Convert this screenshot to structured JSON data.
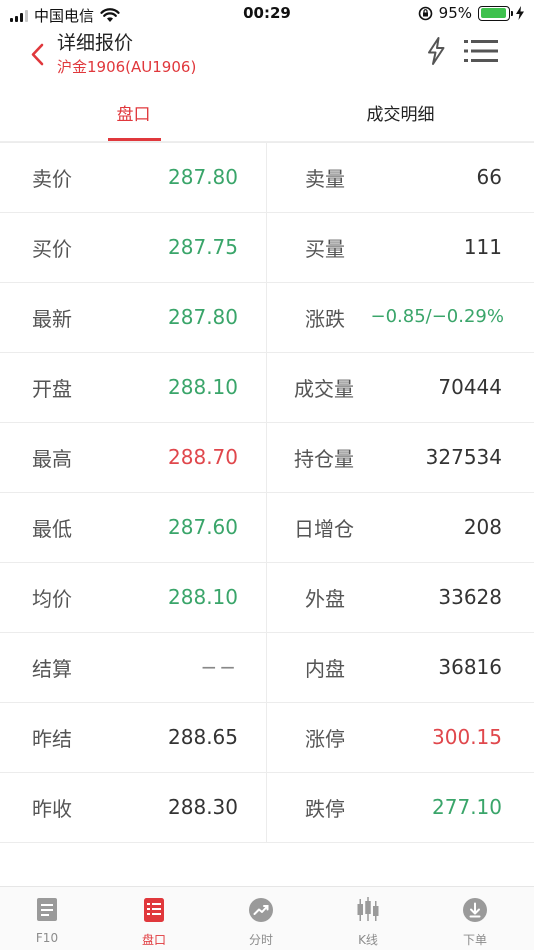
{
  "status_bar": {
    "carrier": "中国电信",
    "time": "00:29",
    "battery": "95%",
    "battery_level": 0.95
  },
  "header": {
    "title": "详细报价",
    "subtitle": "沪金1906(AU1906)"
  },
  "tabs": [
    {
      "label": "盘口",
      "active": true
    },
    {
      "label": "成交明细",
      "active": false
    }
  ],
  "quote_rows": [
    {
      "left_label": "卖价",
      "left_value": "287.80",
      "right_label": "卖量",
      "right_value": "66"
    },
    {
      "left_label": "买价",
      "left_value": "287.75",
      "right_label": "买量",
      "right_value": "111"
    },
    {
      "left_label": "最新",
      "left_value": "287.80",
      "right_label": "涨跌",
      "right_value": "−0.85/−0.29%"
    },
    {
      "left_label": "开盘",
      "left_value": "288.10",
      "right_label": "成交量",
      "right_value": "70444"
    },
    {
      "left_label": "最高",
      "left_value": "288.70",
      "right_label": "持仓量",
      "right_value": "327534"
    },
    {
      "left_label": "最低",
      "left_value": "287.60",
      "right_label": "日增仓",
      "right_value": "208"
    },
    {
      "left_label": "均价",
      "left_value": "288.10",
      "right_label": "外盘",
      "right_value": "33628"
    },
    {
      "left_label": "结算",
      "left_value": "−−",
      "right_label": "内盘",
      "right_value": "36816"
    },
    {
      "left_label": "昨结",
      "left_value": "288.65",
      "right_label": "涨停",
      "right_value": "300.15"
    },
    {
      "left_label": "昨收",
      "left_value": "288.30",
      "right_label": "跌停",
      "right_value": "277.10"
    }
  ],
  "tab_bar": [
    {
      "label": "F10",
      "icon": "document-icon",
      "active": false
    },
    {
      "label": "盘口",
      "icon": "order-book-icon",
      "active": true
    },
    {
      "label": "分时",
      "icon": "trend-icon",
      "active": false
    },
    {
      "label": "K线",
      "icon": "candlestick-icon",
      "active": false
    },
    {
      "label": "下单",
      "icon": "download-icon",
      "active": false
    }
  ],
  "colors": {
    "accent_red": "#e0383c",
    "price_up": "#e0474c",
    "price_down": "#3aa56a",
    "battery_green": "#3ec14d"
  }
}
